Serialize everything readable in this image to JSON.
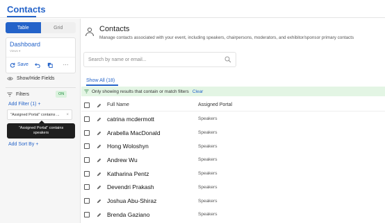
{
  "header": {
    "title": "Contacts"
  },
  "sidebar": {
    "view_toggle": {
      "table": "Table",
      "grid": "Grid"
    },
    "dashboard": {
      "name": "Dashboard",
      "sub": "Views ▾",
      "save_label": "Save",
      "more": "···"
    },
    "show_hide_label": "Show/Hide Fields",
    "filters_label": "Filters",
    "filters_status": "ON",
    "add_filter_label": "Add Filter (1)",
    "filter_chip": "\"Assigned Portal\" contains ...",
    "filter_chip_close": "×",
    "tooltip_line1": "\"Assigned Portal\" contains",
    "tooltip_line2": "speakers",
    "add_sort_label": "Add Sort By"
  },
  "main": {
    "title": "Contacts",
    "subtitle": "Manage contacts associated with your event, including speakers, chairpersons, moderators, and exhibitor/sponsor primary contacts",
    "search_placeholder": "Search by name or email...",
    "tab_label": "Show All (18)",
    "notice": "Only showing results that contain or match filters",
    "clear_label": "Clear",
    "columns": {
      "full_name": "Full Name",
      "assigned_portal": "Assigned Portal"
    }
  },
  "rows": [
    {
      "name": "catrina mcdermott",
      "portal": "Speakers"
    },
    {
      "name": "Arabella MacDonald",
      "portal": "Speakers"
    },
    {
      "name": "Hong Woloshyn",
      "portal": "Speakers"
    },
    {
      "name": "Andrew Wu",
      "portal": "Speakers"
    },
    {
      "name": "Katharina Pentz",
      "portal": "Speakers"
    },
    {
      "name": "Devendri Prakash",
      "portal": "Speakers"
    },
    {
      "name": "Joshua Abu-Shiraz",
      "portal": "Speakers"
    },
    {
      "name": "Brenda Gaziano",
      "portal": "Speakers"
    }
  ],
  "colors": {
    "accent": "#2463c9",
    "notice_bg": "#e3f5e4",
    "on_badge": "#1c8d3c"
  },
  "icons": [
    "sync-icon",
    "undo-icon",
    "copy-icon",
    "eye-icon",
    "filter-icon",
    "person-icon",
    "search-icon",
    "pencil-icon",
    "plus-icon"
  ]
}
